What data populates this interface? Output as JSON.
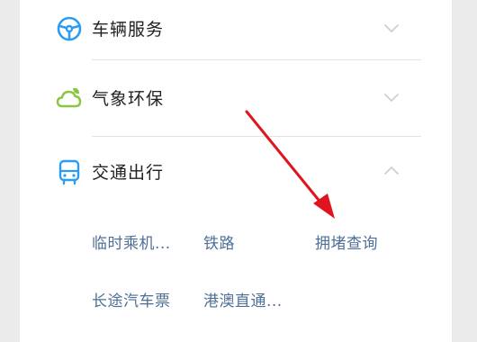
{
  "categories": [
    {
      "title": "车辆服务",
      "icon": "steering-wheel-icon",
      "expanded": false
    },
    {
      "title": "气象环保",
      "icon": "cloud-leaf-icon",
      "expanded": false
    },
    {
      "title": "交通出行",
      "icon": "bus-icon",
      "expanded": true
    }
  ],
  "transport_items": [
    "临时乘机...",
    "铁路",
    "拥堵查询",
    "长途汽车票",
    "港澳直通..."
  ],
  "colors": {
    "vehicle_icon": "#2b9cf2",
    "weather_icon": "#8cc63f",
    "transport_icon": "#2b9cf2",
    "sub_item_text": "#4e6f96",
    "annotation_arrow": "#e0141e"
  }
}
